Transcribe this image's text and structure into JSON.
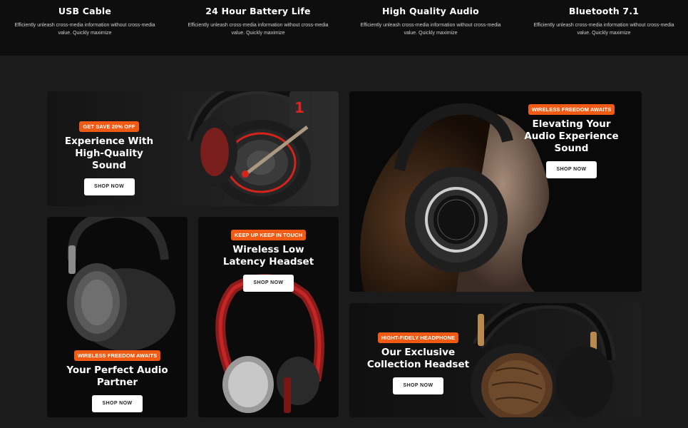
{
  "features": [
    {
      "title": "USB Cable",
      "desc": "Efficiently unleash cross-media information without cross-media value. Quickly maximize"
    },
    {
      "title": "24 Hour Battery Life",
      "desc": "Efficiently unleash cross-media information without cross-media value. Quickly maximize"
    },
    {
      "title": "High Quality Audio",
      "desc": "Efficiently unleash cross-media information without cross-media value. Quickly maximize"
    },
    {
      "title": "Bluetooth 7.1",
      "desc": "Efficiently unleash cross-media information without cross-media value. Quickly maximize"
    }
  ],
  "banners": {
    "high_quality": {
      "badge": "GET SAVE 20% OFF",
      "title": "Experience With High-Quality Sound",
      "button": "SHOP NOW"
    },
    "elevating": {
      "badge": "WIRELESS FREEDOM AWAITS",
      "title": "Elevating Your Audio Experience Sound",
      "button": "SHOP NOW"
    },
    "perfect_partner": {
      "badge": "WIRELESS FREEDOM AWAITS",
      "title": "Your Perfect Audio Partner",
      "button": "SHOP NOW"
    },
    "low_latency": {
      "badge": "KEEP UP KEEP IN TOUCH",
      "title": "Wireless Low Latency Headset",
      "button": "SHOP NOW"
    },
    "collection": {
      "badge": "HIGHT-FIDELY HEADPHONE",
      "title": "Our Exclusive Collection Headset",
      "button": "SHOP NOW"
    }
  },
  "colors": {
    "accent": "#f05a12",
    "background": "#1b1b1b",
    "strip": "#0e0e0e"
  }
}
